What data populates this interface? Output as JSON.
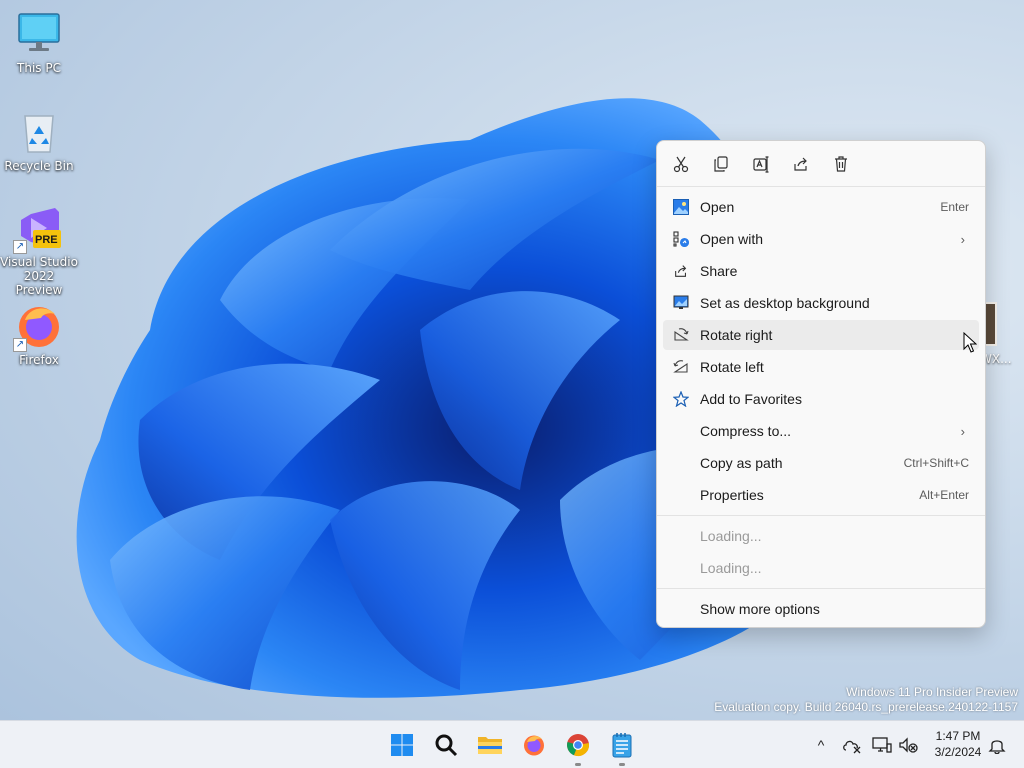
{
  "desktop": {
    "icons": [
      {
        "label": "This PC",
        "icon": "monitor-icon"
      },
      {
        "label": "Recycle Bin",
        "icon": "recycle-bin-icon"
      },
      {
        "label": "Visual Studio 2022 Preview",
        "label_line1": "Visual Studio",
        "label_line2": "2022 Preview",
        "icon": "visual-studio-icon",
        "badge": "PRE"
      },
      {
        "label": "Firefox",
        "icon": "firefox-icon"
      }
    ],
    "partial_icon_label": "WX..."
  },
  "watermark": {
    "line1": "Windows 11 Pro Insider Preview",
    "line2": "Evaluation copy. Build 26040.rs_prerelease.240122-1157"
  },
  "context_menu": {
    "quick_actions": [
      "cut-icon",
      "copy-icon",
      "rename-icon",
      "share-icon",
      "delete-icon"
    ],
    "items": [
      {
        "label": "Open",
        "accel": "Enter",
        "icon": "image-icon"
      },
      {
        "label": "Open with",
        "accel": "",
        "icon": "open-with-icon",
        "submenu": true
      },
      {
        "label": "Share",
        "accel": "",
        "icon": "share-icon"
      },
      {
        "label": "Set as desktop background",
        "accel": "",
        "icon": "desktop-background-icon"
      },
      {
        "label": "Rotate right",
        "accel": "",
        "icon": "rotate-right-icon",
        "hovered": true
      },
      {
        "label": "Rotate left",
        "accel": "",
        "icon": "rotate-left-icon"
      },
      {
        "label": "Add to Favorites",
        "accel": "",
        "icon": "star-icon"
      },
      {
        "label": "Compress to...",
        "accel": "",
        "icon": "",
        "submenu": true
      },
      {
        "label": "Copy as path",
        "accel": "Ctrl+Shift+C",
        "icon": ""
      },
      {
        "label": "Properties",
        "accel": "Alt+Enter",
        "icon": ""
      }
    ],
    "loading_items": [
      "Loading...",
      "Loading..."
    ],
    "more_options": "Show more options",
    "submenu_chevron": "›"
  },
  "taskbar": {
    "apps": [
      "start-icon",
      "search-icon",
      "file-explorer-icon",
      "firefox-icon",
      "chrome-icon",
      "notepad-icon"
    ],
    "tray_chevron": "^",
    "clock": {
      "time": "1:47 PM",
      "date": "3/2/2024"
    }
  },
  "colors": {
    "accent": "#0067c0",
    "wallpaper_blue": "#1565e8",
    "menu_bg": "#f9f9f9",
    "taskbar_bg": "#eef1f6"
  }
}
